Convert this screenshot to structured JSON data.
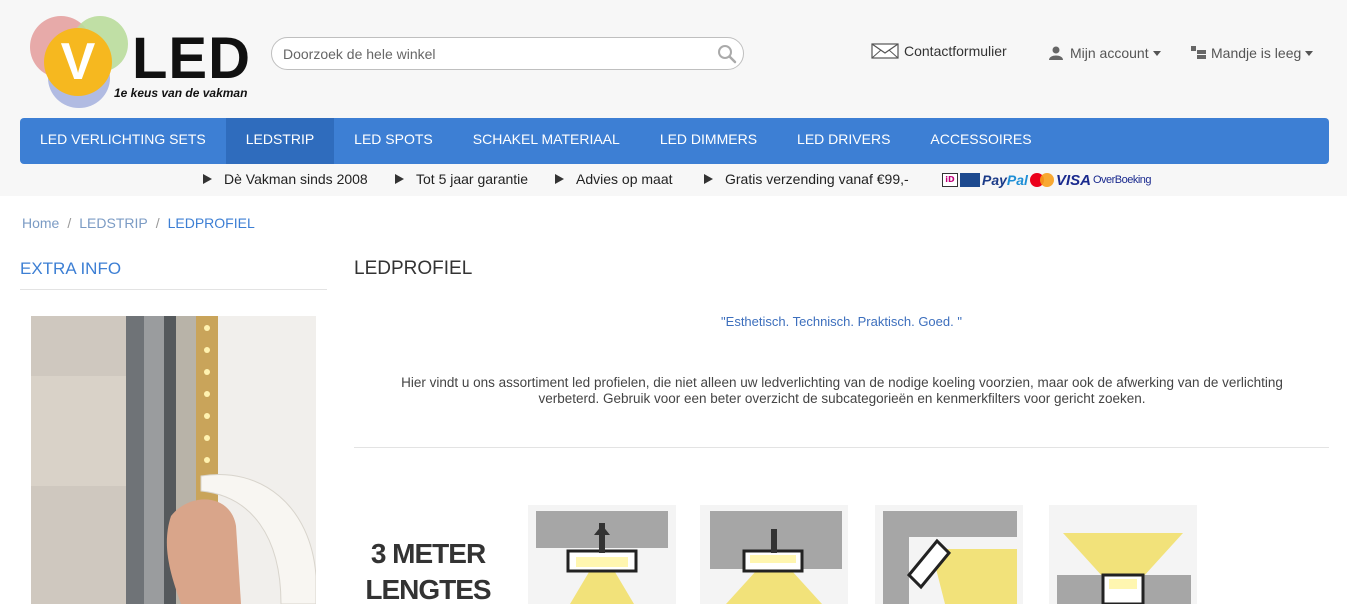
{
  "header": {
    "logo_text": "LED",
    "logo_letter": "V",
    "logo_tagline": "1e keus van de vakman",
    "search_placeholder": "Doorzoek de hele winkel",
    "contact_label": "Contactformulier",
    "account_label": "Mijn account",
    "cart_label": "Mandje is leeg"
  },
  "nav": {
    "items": [
      "LED VERLICHTING SETS",
      "LEDSTRIP",
      "LED SPOTS",
      "SCHAKEL MATERIAAL",
      "LED DIMMERS",
      "LED DRIVERS",
      "ACCESSOIRES"
    ],
    "active_index": 1
  },
  "usps": [
    "Dè Vakman sinds 2008",
    "Tot 5 jaar garantie",
    "Advies op maat",
    "Gratis verzending vanaf €99,-"
  ],
  "payment": {
    "paypal_a": "Pay",
    "paypal_b": "Pal",
    "visa": "VISA",
    "overboeking": "OverBoeking"
  },
  "breadcrumb": {
    "home": "Home",
    "level1": "LEDSTRIP",
    "current": "LEDPROFIEL",
    "separator": "/"
  },
  "sidebar": {
    "title": "EXTRA INFO"
  },
  "main": {
    "title": "LEDPROFIEL",
    "quote": "\"Esthetisch. Technisch. Praktisch. Goed. \"",
    "intro_line1": "Hier vindt u ons assortiment led profielen, die niet alleen uw ledverlichting van de nodige koeling voorzien, maar ook de afwerking van de verlichting",
    "intro_line2": "verbeterd. Gebruik voor een beter overzicht de subcategorieën en kenmerkfilters voor gericht zoeken.",
    "promo_line1": "3 METER",
    "promo_line2": "LENGTES"
  },
  "colors": {
    "accent": "#3d7fd4",
    "nav_active": "#2f6cbd",
    "header_bg": "#f7f7f7",
    "logo_yellow": "#f6b81f"
  },
  "icons": [
    "search-icon",
    "envelope-icon",
    "user-icon",
    "cart-icon",
    "chevron-down-icon",
    "triangle-bullet-icon"
  ]
}
